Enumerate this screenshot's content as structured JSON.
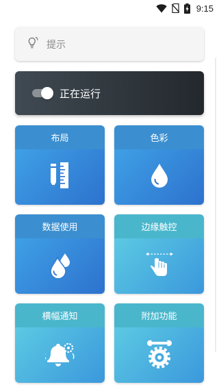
{
  "status_bar": {
    "time": "9:15",
    "icons": [
      "wifi-icon",
      "no-sim-icon",
      "battery-charging-icon"
    ]
  },
  "hint": {
    "icon": "lightbulb-icon",
    "label": "提示"
  },
  "service": {
    "label": "正在运行",
    "toggle_state": "on"
  },
  "tiles": [
    {
      "label": "布局",
      "icon": "pencil-ruler-icon",
      "style": "blue"
    },
    {
      "label": "色彩",
      "icon": "water-drop-icon",
      "style": "blue"
    },
    {
      "label": "数据使用",
      "icon": "data-drops-icon",
      "style": "blue"
    },
    {
      "label": "边缘触控",
      "icon": "swipe-gesture-icon",
      "style": "cyan"
    },
    {
      "label": "横幅通知",
      "icon": "bell-gear-icon",
      "style": "cyan"
    },
    {
      "label": "附加功能",
      "icon": "wrench-gear-icon",
      "style": "cyan"
    }
  ],
  "colors": {
    "run_card": "#2b3137",
    "tile_blue": "#3b8fd0",
    "tile_cyan": "#4ab6cc"
  }
}
